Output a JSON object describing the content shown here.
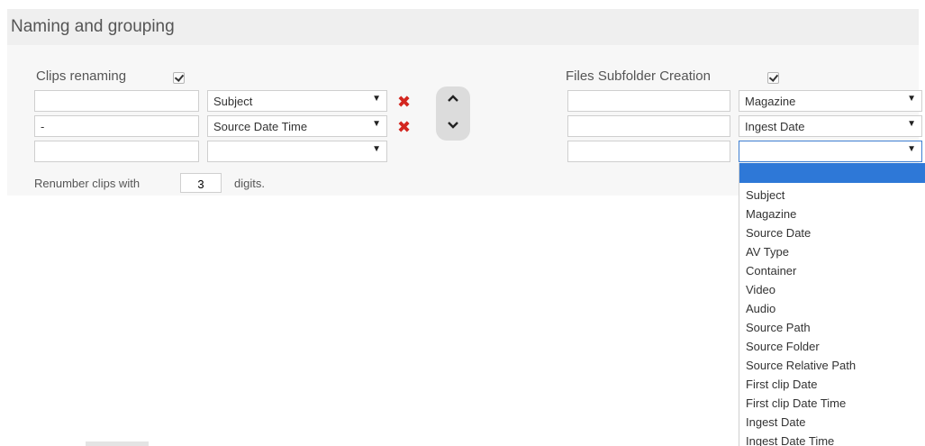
{
  "panel": {
    "title": "Naming and grouping"
  },
  "clips_renaming": {
    "label": "Clips renaming",
    "checked": true,
    "rows": [
      {
        "text": "",
        "select": "Subject",
        "removable": true
      },
      {
        "text": "-",
        "select": "Source Date Time",
        "removable": true
      },
      {
        "text": "",
        "select": "",
        "removable": false
      }
    ],
    "renumber_prefix": "Renumber clips with",
    "renumber_digits": "3",
    "renumber_suffix": "digits."
  },
  "files_subfolder": {
    "label": "Files Subfolder Creation",
    "checked": true,
    "rows": [
      {
        "text": "",
        "select": "Magazine"
      },
      {
        "text": "",
        "select": "Ingest Date"
      },
      {
        "text": "",
        "select": ""
      }
    ]
  },
  "dropdown": {
    "options": [
      "Subject",
      "Magazine",
      "Source Date",
      "AV Type",
      "Container",
      "Video",
      "Audio",
      "Source Path",
      "Source Folder",
      "Source Relative Path",
      "First clip Date",
      "First clip Date Time",
      "Ingest Date",
      "Ingest Date Time"
    ]
  },
  "icons": {
    "remove": "x-icon",
    "move_up": "chevron-up-icon",
    "move_down": "chevron-down-icon",
    "dropdown_arrow": "triangle-down-icon",
    "checkbox": "checkmark-icon"
  },
  "colors": {
    "header_bg": "#efefef",
    "panel_bg": "#f7f7f7",
    "remove_red": "#d3261f",
    "highlight_blue": "#2e78d7"
  }
}
